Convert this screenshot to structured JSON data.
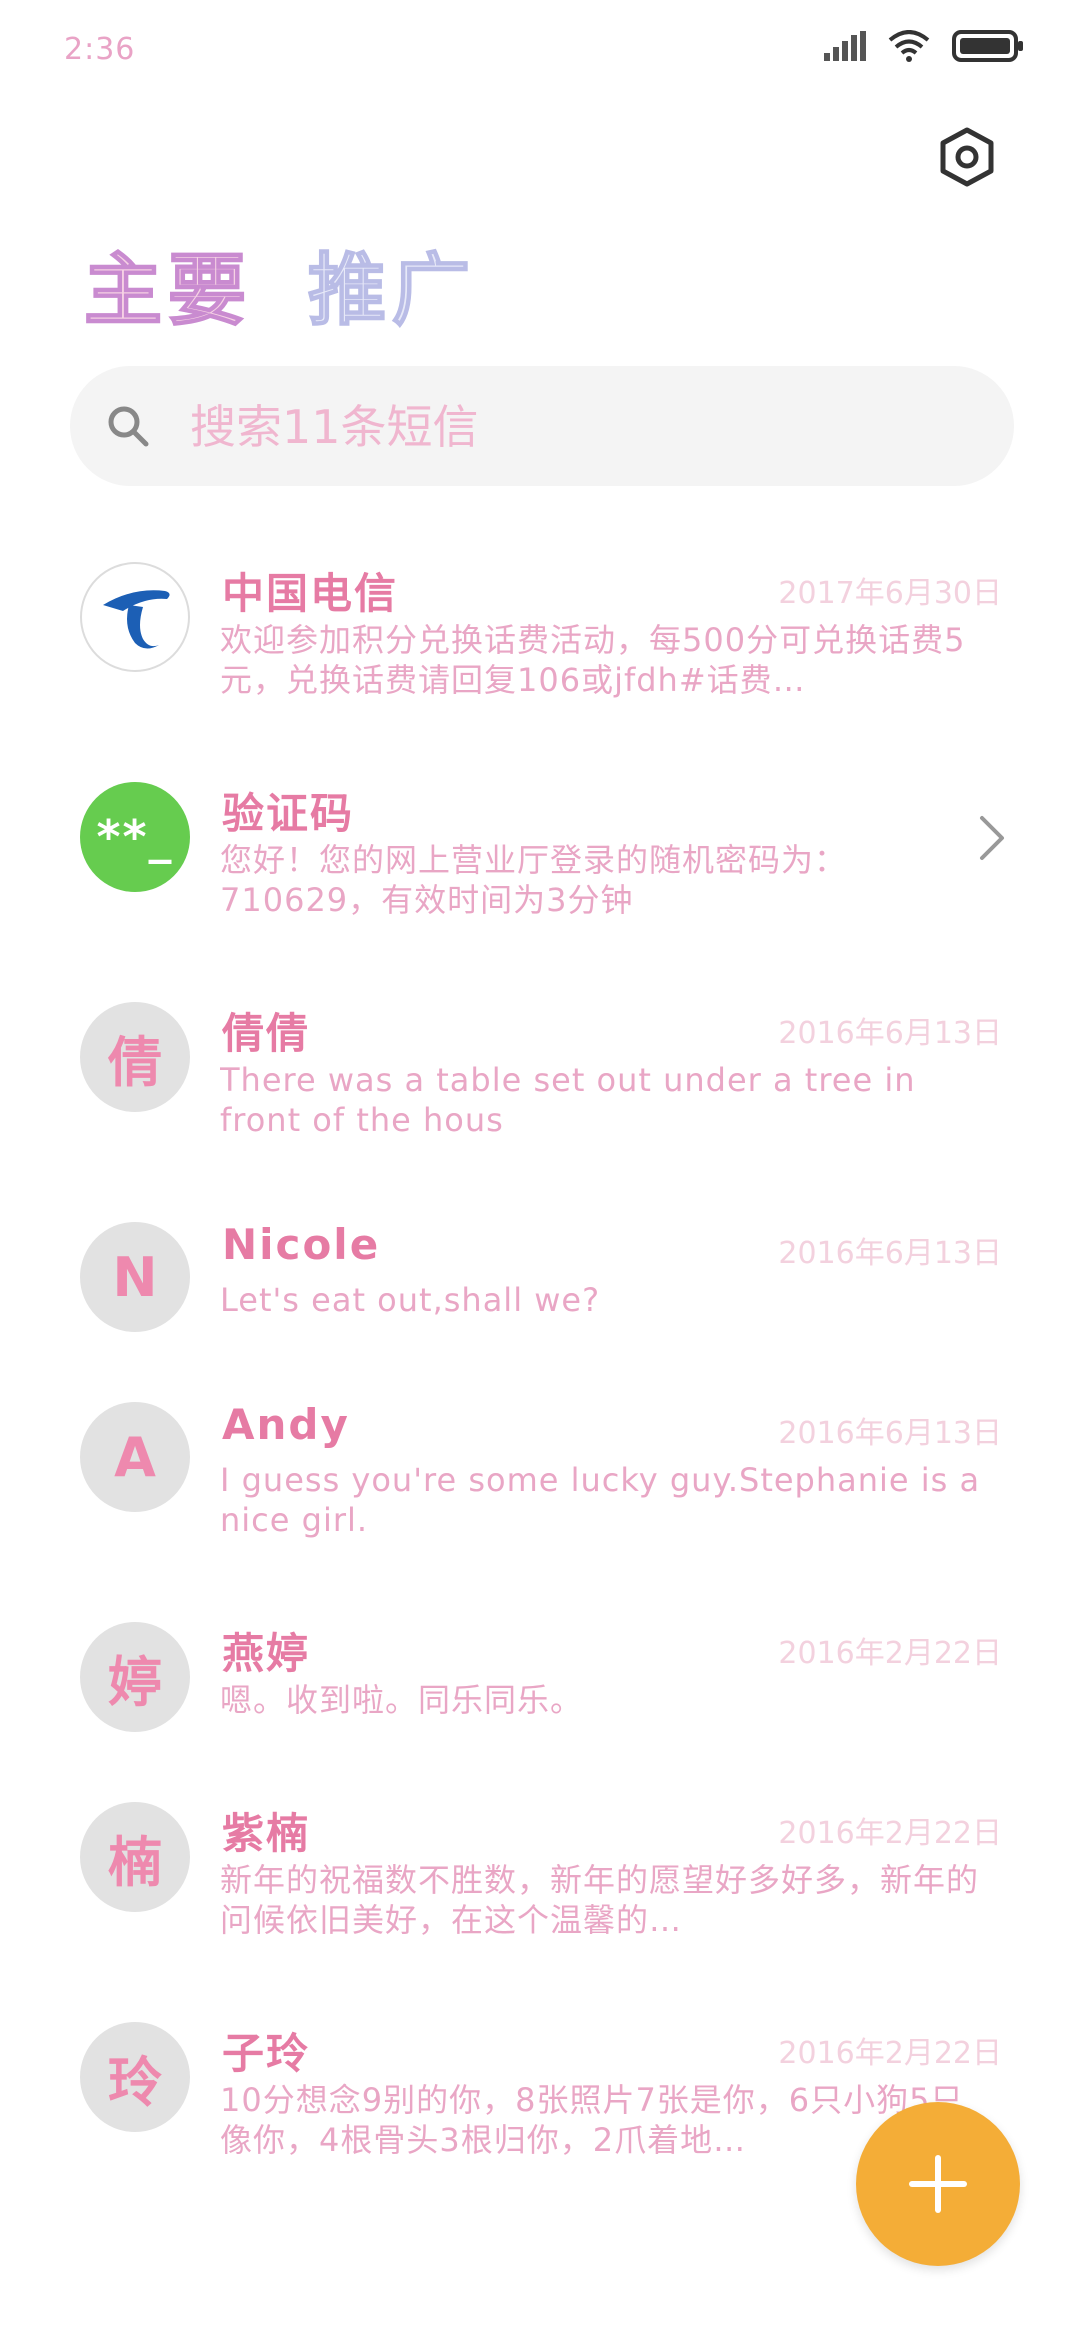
{
  "status_bar": {
    "time": "2:36",
    "icons": [
      "signal-icon",
      "wifi-icon",
      "battery-icon"
    ]
  },
  "header": {
    "settings_icon": "settings-icon"
  },
  "tabs": [
    {
      "label": "主要"
    },
    {
      "label": "推广"
    }
  ],
  "search": {
    "placeholder": "搜索11条短信"
  },
  "conversations": [
    {
      "name": "中国电信",
      "date": "2017年6月30日",
      "preview": "欢迎参加积分兑换话费活动，每500分可兑换话费5元，兑换话费请回复106或jfdh#话费…",
      "avatar": "telecom-logo"
    },
    {
      "name": "验证码",
      "date": "",
      "preview": "您好！您的网上营业厅登录的随机密码为：710629，有效时间为3分钟",
      "avatar": "**_"
    },
    {
      "name": "倩倩",
      "date": "2016年6月13日",
      "preview": "There was a table set out under a tree in front of the hous",
      "avatar": "倩"
    },
    {
      "name": "Nicole",
      "date": "2016年6月13日",
      "preview": "Let's eat out,shall we?",
      "avatar": "N"
    },
    {
      "name": "Andy",
      "date": "2016年6月13日",
      "preview": "I guess you're some lucky guy.Stephanie is a nice girl.",
      "avatar": "A"
    },
    {
      "name": "燕婷",
      "date": "2016年2月22日",
      "preview": "嗯。收到啦。同乐同乐。",
      "avatar": "婷"
    },
    {
      "name": "紫楠",
      "date": "2016年2月22日",
      "preview": "新年的祝福数不胜数，新年的愿望好多好多，新年的问候依旧美好，在这个温馨的…",
      "avatar": "楠"
    },
    {
      "name": "子玲",
      "date": "2016年2月22日",
      "preview": "10分想念9别的你，8张照片7张是你，6只小狗5只像你，4根骨头3根归你，2爪着地…",
      "avatar": "玲"
    }
  ],
  "fab": {
    "icon": "plus-icon"
  },
  "colors": {
    "accent": "#f4ad37",
    "text_pink": "#e67ba4",
    "verify_green": "#66cc4f"
  }
}
